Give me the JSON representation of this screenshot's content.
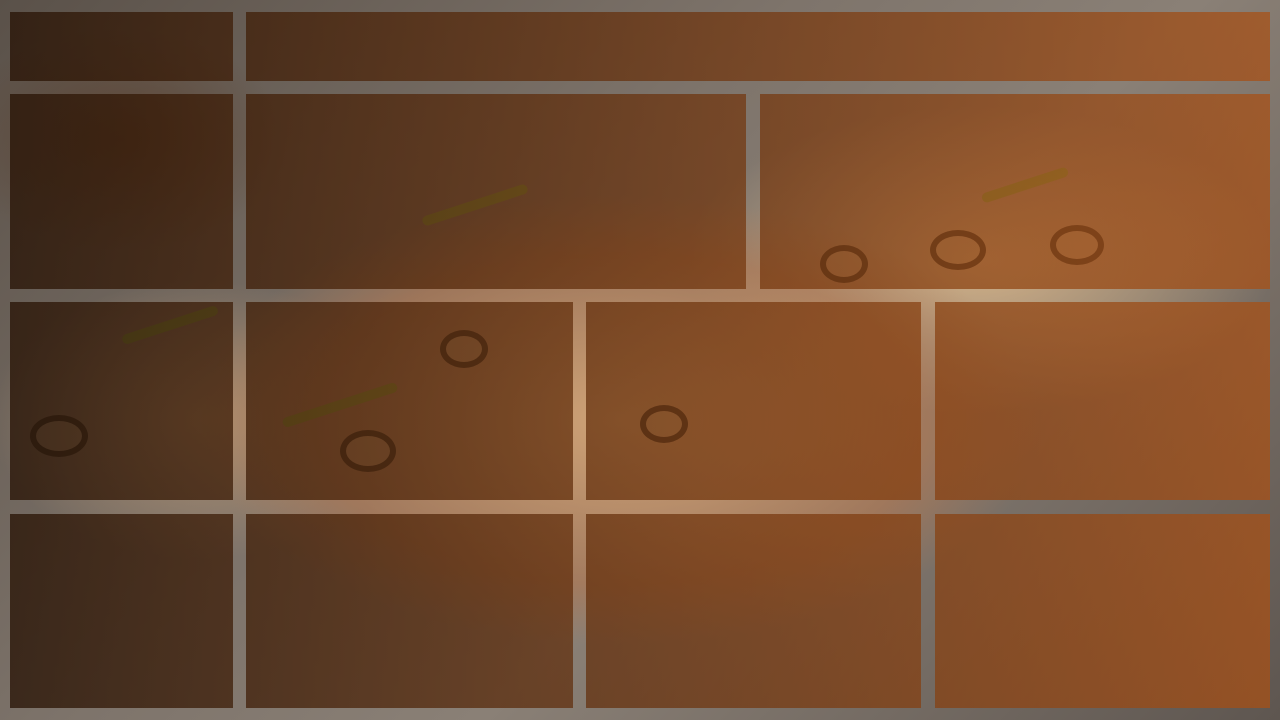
{
  "background": {
    "subject": "pizza-photo",
    "overlay_color_start": "#2a1406",
    "overlay_color_end": "#b05a1a"
  },
  "tiles": [
    {
      "name": "tile-r1-c1"
    },
    {
      "name": "tile-r1-c2"
    },
    {
      "name": "tile-r2-c1"
    },
    {
      "name": "tile-r2-c2"
    },
    {
      "name": "tile-r2-c3"
    },
    {
      "name": "tile-r3-c1"
    },
    {
      "name": "tile-r3-c2"
    },
    {
      "name": "tile-r3-c3"
    },
    {
      "name": "tile-r3-c4"
    },
    {
      "name": "tile-r4-c1"
    },
    {
      "name": "tile-r4-c2"
    },
    {
      "name": "tile-r4-c3"
    },
    {
      "name": "tile-r4-c4"
    }
  ]
}
